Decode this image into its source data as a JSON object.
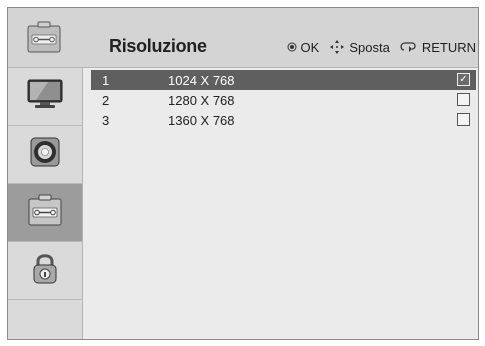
{
  "header": {
    "title": "Risoluzione",
    "icon": "tools-icon"
  },
  "hints": [
    {
      "icon": "ok-dot-icon",
      "label": "OK"
    },
    {
      "icon": "move-arrows-icon",
      "label": "Sposta"
    },
    {
      "icon": "return-icon",
      "label": "RETURN"
    }
  ],
  "sidebar": {
    "items": [
      {
        "icon": "monitor-icon",
        "active": false
      },
      {
        "icon": "speaker-icon",
        "active": false
      },
      {
        "icon": "tools-icon",
        "active": true
      },
      {
        "icon": "lock-icon",
        "active": false
      }
    ]
  },
  "resolutions": [
    {
      "index": "1",
      "value": "1024 X 768",
      "checked": true,
      "selected": true
    },
    {
      "index": "2",
      "value": "1280 X 768",
      "checked": false,
      "selected": false
    },
    {
      "index": "3",
      "value": "1360 X 768",
      "checked": false,
      "selected": false
    }
  ],
  "check_glyph": "✓"
}
